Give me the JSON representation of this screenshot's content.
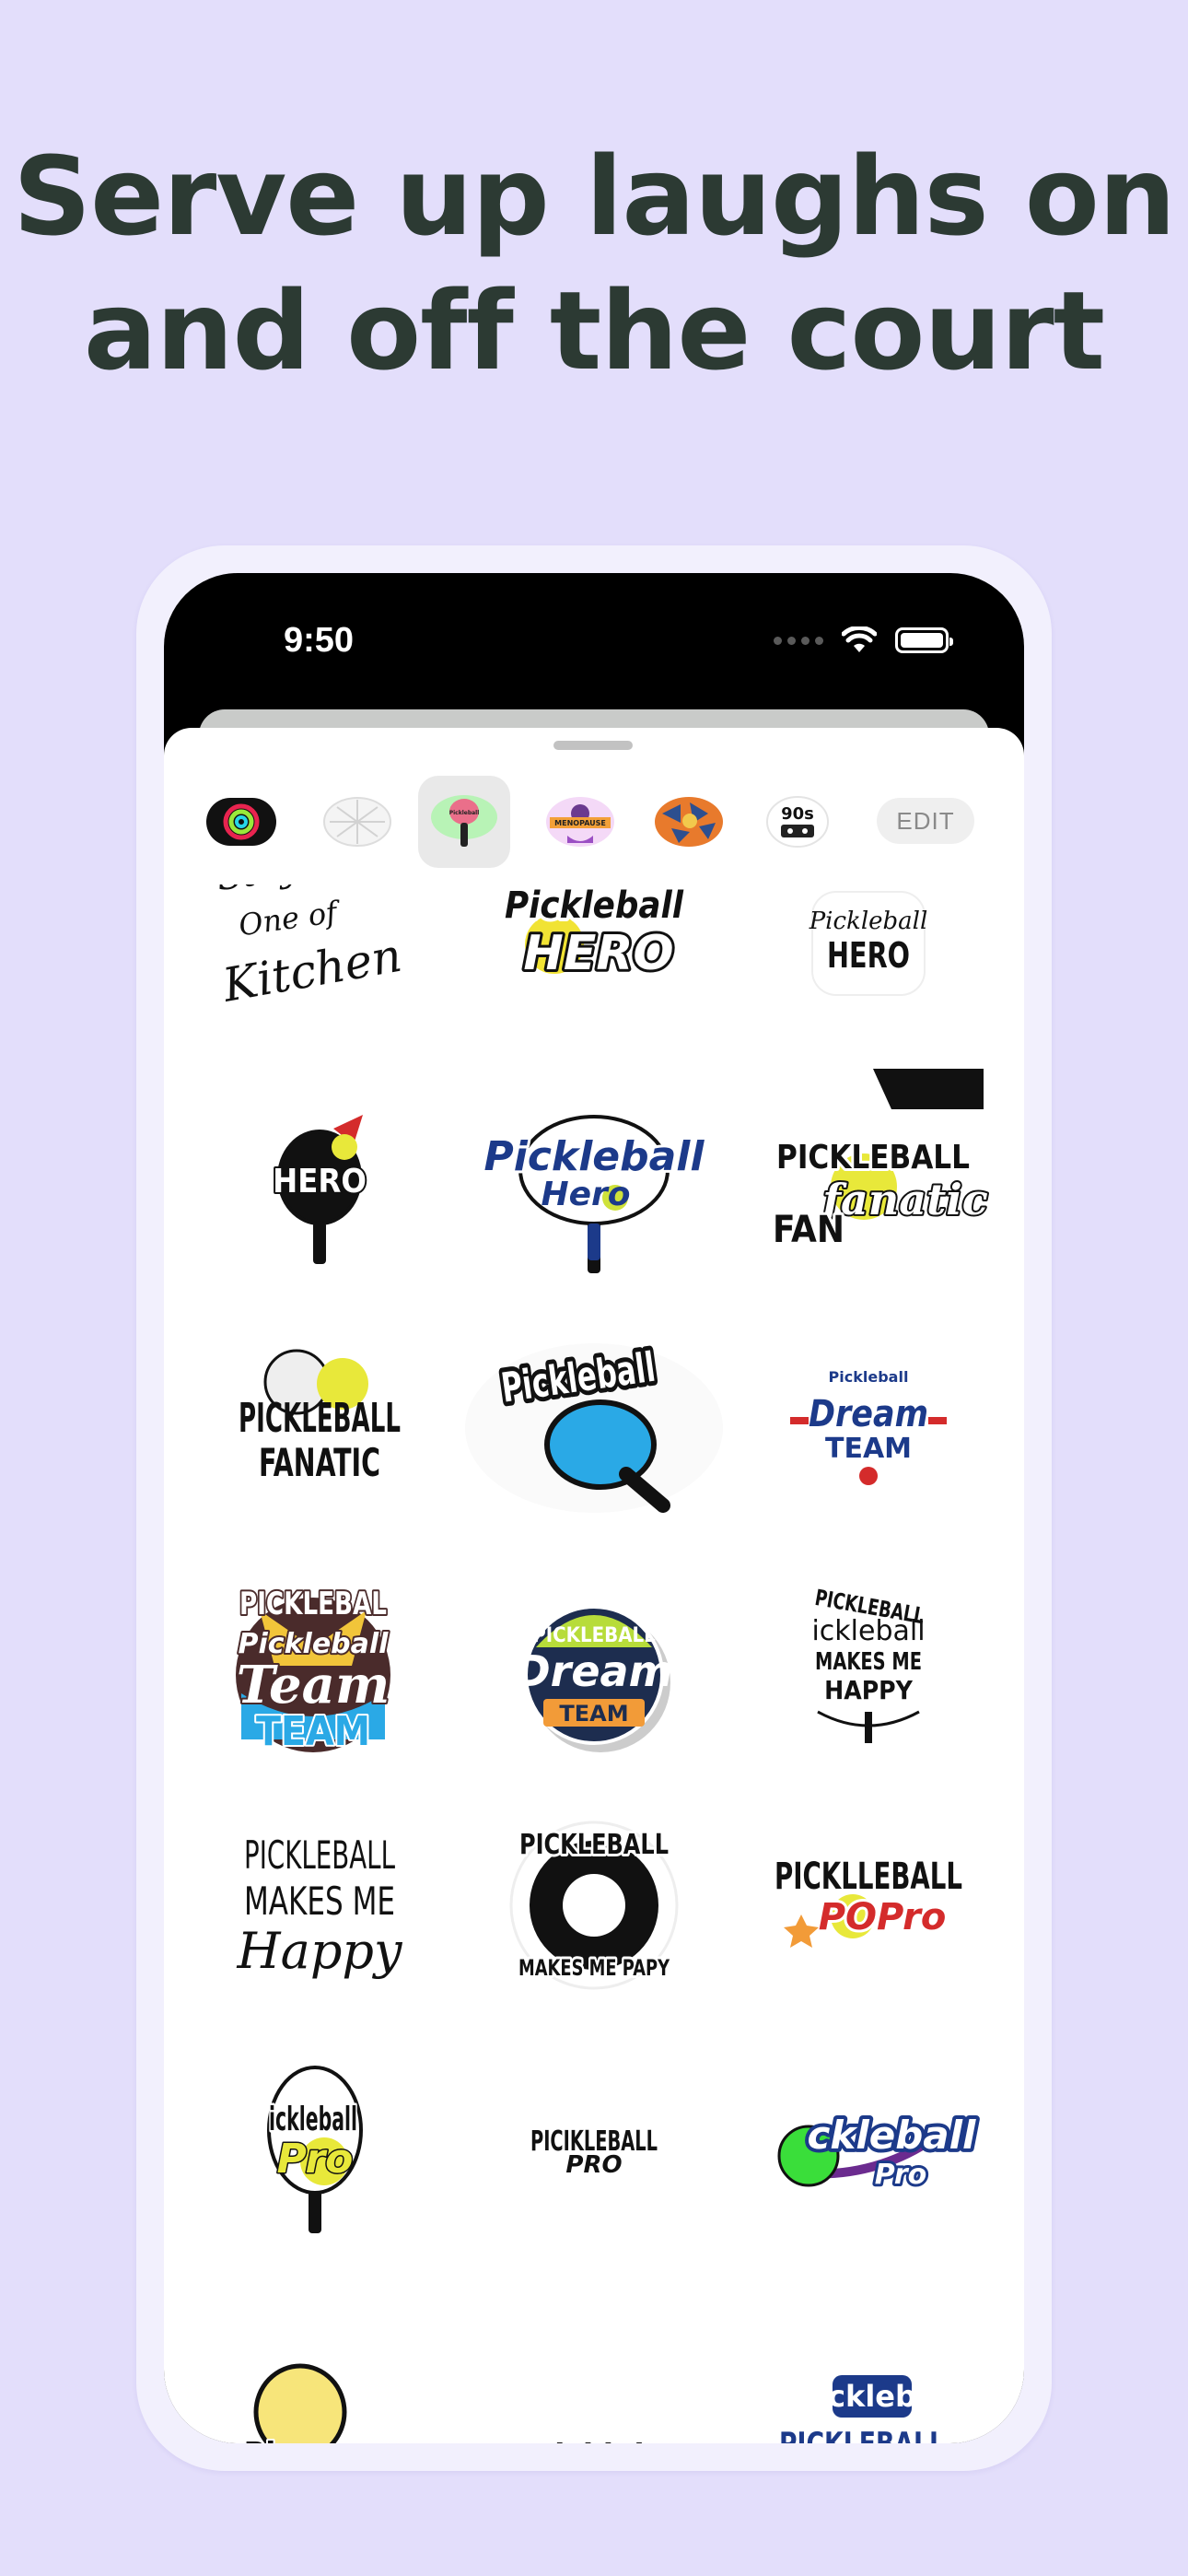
{
  "headline": {
    "line1": "Serve up laughs on",
    "line2": "and off the court"
  },
  "status_bar": {
    "time": "9:50"
  },
  "pack_bar": {
    "packs": [
      {
        "icon": "activity-rings-icon"
      },
      {
        "icon": "grid-sticker-icon"
      },
      {
        "icon": "pickleball-paddle-icon",
        "selected": true,
        "label": "Pickleball"
      },
      {
        "icon": "menopause-sticker-icon",
        "label": "MENOPAUSE"
      },
      {
        "icon": "pattern-sticker-icon"
      },
      {
        "icon": "cassette-90s-icon",
        "label": "90s"
      }
    ],
    "edit_label": "EDIT"
  },
  "stickers": [
    {
      "lines": [
        "Stay",
        "One of",
        "Kitchen"
      ]
    },
    {
      "lines": [
        "Pickleball",
        "HERO"
      ]
    },
    {
      "lines": [
        "Pickleball",
        "HERO"
      ]
    },
    {
      "lines": [
        "HERO"
      ]
    },
    {
      "lines": [
        "Pickleball",
        "Hero"
      ]
    },
    {
      "lines": [
        "PICKLEBALL",
        "fanatic",
        "FAN"
      ]
    },
    {
      "lines": [
        "PICKLEBALL",
        "FANATIC"
      ]
    },
    {
      "lines": [
        "Pickleball"
      ]
    },
    {
      "lines": [
        "Pickleball",
        "Dream",
        "TEAM"
      ]
    },
    {
      "lines": [
        "PICKLEBAL",
        "Pickleball",
        "Team",
        "TEAM"
      ]
    },
    {
      "lines": [
        "PICKLEBALL",
        "Dream",
        "TEAM"
      ]
    },
    {
      "lines": [
        "PICKLEBALL",
        "ickleball",
        "MAKES ME",
        "HAPPY"
      ]
    },
    {
      "lines": [
        "PICKLEBALL",
        "MAKES ME",
        "Happy"
      ]
    },
    {
      "lines": [
        "PICKLEBALL",
        "MAKES ME PAPY"
      ]
    },
    {
      "lines": [
        "PICKLLEBALL",
        "POPro"
      ]
    },
    {
      "lines": [
        "ickleball",
        "Pro"
      ]
    },
    {
      "lines": [
        "PICIKLEBALL",
        "PRO"
      ]
    },
    {
      "lines": [
        "ckleball",
        "Pro"
      ]
    },
    {
      "lines": [
        "Pi"
      ]
    },
    {
      "lines": [
        "Pickleb"
      ]
    },
    {
      "lines": [
        "ckleb",
        "PICKLEBALL"
      ]
    }
  ],
  "colors": {
    "page_bg": "#e3defb",
    "headline": "#2c3a33",
    "accent_blue": "#1c3a8a",
    "pickleball_yellow": "#e8e83a"
  }
}
